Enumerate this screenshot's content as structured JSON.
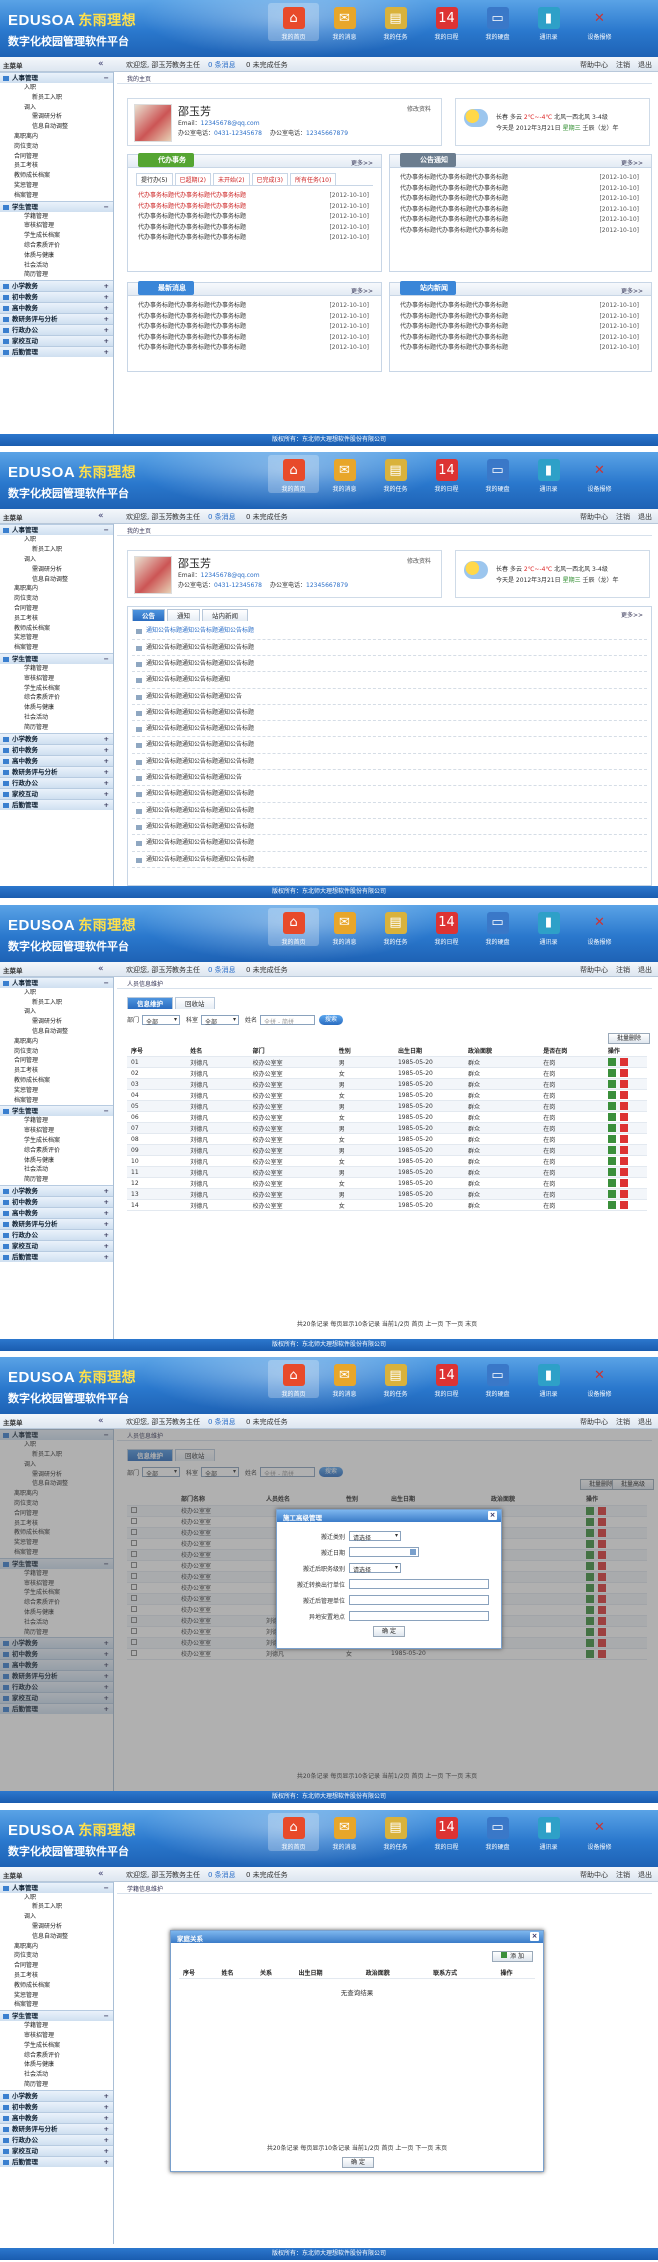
{
  "app": {
    "logo": "EDUSOA",
    "logo_cn": "东雨理想",
    "subtitle": "数字化校园管理软件平台",
    "nav": [
      {
        "label": "我的首页",
        "icon": "home-icon",
        "glyph": "⌂",
        "color": "#e84a2a"
      },
      {
        "label": "我的消息",
        "icon": "envelope-icon",
        "glyph": "✉",
        "color": "#e8a62a"
      },
      {
        "label": "我的任务",
        "icon": "folder-icon",
        "glyph": "▤",
        "color": "#d9b23c"
      },
      {
        "label": "我的日程",
        "icon": "calendar-icon",
        "glyph": "14",
        "color": "#d33"
      },
      {
        "label": "我的硬盘",
        "icon": "monitor-icon",
        "glyph": "▭",
        "color": "#3a78c8"
      },
      {
        "label": "通讯录",
        "icon": "addressbook-icon",
        "glyph": "▮",
        "color": "#2ea0c8"
      },
      {
        "label": "设备报修",
        "icon": "tools-icon",
        "glyph": "✕",
        "color": "#eee"
      }
    ],
    "toolbar": {
      "menu": "主菜单",
      "collapse": "«",
      "welcome": "欢迎您, 邵玉芳",
      "dept": "教务主任",
      "msg": "0 条消息",
      "task": "0 未完成任务",
      "help": "帮助中心",
      "logout": "注销",
      "exit": "退出"
    },
    "footer": "版权所有：东北师大理想软件股份有限公司"
  },
  "sidebar": {
    "groups_top": [
      {
        "label": "人事管理",
        "toggle": "−"
      }
    ],
    "hr_items": [
      {
        "label": "入职",
        "level": 2
      },
      {
        "label": "新员工入职",
        "level": 3
      },
      {
        "label": "调入",
        "level": 2
      },
      {
        "label": "需调研分析",
        "level": 3
      },
      {
        "label": "信息自动调整",
        "level": 3
      },
      {
        "label": "离职离内",
        "level": 1
      },
      {
        "label": "岗位变动",
        "level": 1
      },
      {
        "label": "合同管理",
        "level": 1
      },
      {
        "label": "员工考核",
        "level": 1
      },
      {
        "label": "教师成长档案",
        "level": 1
      },
      {
        "label": "奖惩管理",
        "level": 1
      },
      {
        "label": "档案管理",
        "level": 1
      }
    ],
    "student_group": {
      "label": "学生管理",
      "toggle": "−"
    },
    "student_items": [
      "学籍管理",
      "审核招管理",
      "学生成长档案",
      "综合素质评价",
      "体质与健康",
      "社会活动",
      "简历管理"
    ],
    "bottom_groups": [
      {
        "label": "小学教务",
        "toggle": "+"
      },
      {
        "label": "初中教务",
        "toggle": "+"
      },
      {
        "label": "高中教务",
        "toggle": "+"
      },
      {
        "label": "教研务评与分析",
        "toggle": "+"
      },
      {
        "label": "行政办公",
        "toggle": "+"
      },
      {
        "label": "家校互动",
        "toggle": "+"
      },
      {
        "label": "后勤管理",
        "toggle": "+"
      }
    ]
  },
  "home": {
    "breadcrumb": "我的主页",
    "profile": {
      "name": "邵玉芳",
      "email_label": "Email：",
      "email": "12345678@qq.com",
      "phone_label": "办公室电话：",
      "phone": "0431-12345678",
      "mobile_label": "办公室电话：",
      "mobile": "12345667879",
      "edit": "修改资料"
    },
    "weather": {
      "city": "长春",
      "cond": "多云",
      "temp": "2℃~-4℃",
      "wind": "北风一西北风  3-4级",
      "today": "今天是  2012年3月21日",
      "weekday": "星期三",
      "lunar": "壬辰（龙）年"
    },
    "todo": {
      "title": "代办事务",
      "more": "更多>>",
      "tabs": [
        "提行办(5)",
        "已超期(2)",
        "未开始(2)",
        "已完成(3)",
        "所有任务(10)"
      ],
      "rows": [
        {
          "text": "代办事务标题代办事务标题代办事务标题",
          "date": "[2012-10-10]",
          "red": true
        },
        {
          "text": "代办事务标题代办事务标题代办事务标题",
          "date": "[2012-10-10]",
          "red": true
        },
        {
          "text": "代办事务标题代办事务标题代办事务标题",
          "date": "[2012-10-10]",
          "red": false
        },
        {
          "text": "代办事务标题代办事务标题代办事务标题",
          "date": "[2012-10-10]",
          "red": false
        },
        {
          "text": "代办事务标题代办事务标题代办事务标题",
          "date": "[2012-10-10]",
          "red": false
        }
      ]
    },
    "notice": {
      "title": "公告通知",
      "more": "更多>>",
      "rows": [
        {
          "text": "代办事务标题代办事务标题代办事务标题",
          "date": "[2012-10-10]"
        },
        {
          "text": "代办事务标题代办事务标题代办事务标题",
          "date": "[2012-10-10]"
        },
        {
          "text": "代办事务标题代办事务标题代办事务标题",
          "date": "[2012-10-10]"
        },
        {
          "text": "代办事务标题代办事务标题代办事务标题",
          "date": "[2012-10-10]"
        },
        {
          "text": "代办事务标题代办事务标题代办事务标题",
          "date": "[2012-10-10]"
        },
        {
          "text": "代办事务标题代办事务标题代办事务标题",
          "date": "[2012-10-10]"
        }
      ]
    },
    "news": {
      "title": "最新消息",
      "more": "更多>>",
      "rows": [
        {
          "text": "代办事务标题代办事务标题代办事务标题",
          "date": "[2012-10-10]"
        },
        {
          "text": "代办事务标题代办事务标题代办事务标题",
          "date": "[2012-10-10]"
        },
        {
          "text": "代办事务标题代办事务标题代办事务标题",
          "date": "[2012-10-10]"
        },
        {
          "text": "代办事务标题代办事务标题代办事务标题",
          "date": "[2012-10-10]"
        },
        {
          "text": "代办事务标题代办事务标题代办事务标题",
          "date": "[2012-10-10]"
        }
      ]
    },
    "site_news": {
      "title": "站内新闻",
      "more": "更多>>",
      "rows": [
        {
          "text": "代办事务标题代办事务标题代办事务标题",
          "date": "[2012-10-10]"
        },
        {
          "text": "代办事务标题代办事务标题代办事务标题",
          "date": "[2012-10-10]"
        },
        {
          "text": "代办事务标题代办事务标题代办事务标题",
          "date": "[2012-10-10]"
        },
        {
          "text": "代办事务标题代办事务标题代办事务标题",
          "date": "[2012-10-10]"
        },
        {
          "text": "代办事务标题代办事务标题代办事务标题",
          "date": "[2012-10-10]"
        }
      ]
    }
  },
  "bulletin": {
    "tabs": [
      "公告",
      "通知",
      "站内新闻"
    ],
    "more": "更多>>",
    "items": [
      {
        "text": "通知公告标题通知公告标题通知公告标题",
        "hl": true
      },
      {
        "text": "通知公告标题通知公告标题通知公告标题",
        "hl": false
      },
      {
        "text": "通知公告标题通知公告标题通知公告标题",
        "hl": false
      },
      {
        "text": "通知公告标题通知公告标题通知",
        "hl": false
      },
      {
        "text": "通知公告标题通知公告标题通知公告",
        "hl": false
      },
      {
        "text": "通知公告标题通知公告标题通知公告标题",
        "hl": false
      },
      {
        "text": "通知公告标题通知公告标题通知公告标题",
        "hl": false
      },
      {
        "text": "通知公告标题通知公告标题通知公告标题",
        "hl": false
      },
      {
        "text": "通知公告标题通知公告标题通知公告标题",
        "hl": false
      },
      {
        "text": "通知公告标题通知公告标题通知公告",
        "hl": false
      },
      {
        "text": "通知公告标题通知公告标题通知公告标题",
        "hl": false
      },
      {
        "text": "通知公告标题通知公告标题通知公告标题",
        "hl": false
      },
      {
        "text": "通知公告标题通知公告标题通知公告标题",
        "hl": false
      },
      {
        "text": "通知公告标题通知公告标题通知公告标题",
        "hl": false
      },
      {
        "text": "通知公告标题通知公告标题通知公告标题",
        "hl": false
      }
    ]
  },
  "staff": {
    "breadcrumb": "人员信息维护",
    "tabs": [
      "信息维护",
      "回收站"
    ],
    "filter": {
      "dept_label": "部门",
      "dept_val": "全部",
      "room_label": "科室",
      "room_val": "全部",
      "name_label": "姓名",
      "name_ph": "全拼 - 简拼",
      "search": "搜索"
    },
    "batch_delete": "批量删除",
    "columns": [
      "序号",
      "姓名",
      "部门",
      "性别",
      "出生日期",
      "政治面貌",
      "是否在岗",
      "操作"
    ],
    "rows": [
      [
        "01",
        "刘德凡",
        "校办公室室",
        "男",
        "1985-05-20",
        "群众",
        "在岗"
      ],
      [
        "02",
        "刘德凡",
        "校办公室室",
        "女",
        "1985-05-20",
        "群众",
        "在岗"
      ],
      [
        "03",
        "刘德凡",
        "校办公室室",
        "男",
        "1985-05-20",
        "群众",
        "在岗"
      ],
      [
        "04",
        "刘德凡",
        "校办公室室",
        "女",
        "1985-05-20",
        "群众",
        "在岗"
      ],
      [
        "05",
        "刘德凡",
        "校办公室室",
        "男",
        "1985-05-20",
        "群众",
        "在岗"
      ],
      [
        "06",
        "刘德凡",
        "校办公室室",
        "女",
        "1985-05-20",
        "群众",
        "在岗"
      ],
      [
        "07",
        "刘德凡",
        "校办公室室",
        "男",
        "1985-05-20",
        "群众",
        "在岗"
      ],
      [
        "08",
        "刘德凡",
        "校办公室室",
        "女",
        "1985-05-20",
        "群众",
        "在岗"
      ],
      [
        "09",
        "刘德凡",
        "校办公室室",
        "男",
        "1985-05-20",
        "群众",
        "在岗"
      ],
      [
        "10",
        "刘德凡",
        "校办公室室",
        "女",
        "1985-05-20",
        "群众",
        "在岗"
      ],
      [
        "11",
        "刘德凡",
        "校办公室室",
        "男",
        "1985-05-20",
        "群众",
        "在岗"
      ],
      [
        "12",
        "刘德凡",
        "校办公室室",
        "女",
        "1985-05-20",
        "群众",
        "在岗"
      ],
      [
        "13",
        "刘德凡",
        "校办公室室",
        "男",
        "1985-05-20",
        "群众",
        "在岗"
      ],
      [
        "14",
        "刘德凡",
        "校办公室室",
        "女",
        "1985-05-20",
        "群众",
        "在岗"
      ]
    ],
    "pager": "共20条记录    每页显示10条记录    当前1/2页    首页    上一页    下一页    末页"
  },
  "dialog1": {
    "title": "施工高级管理",
    "fields": [
      {
        "label": "搬迁类别",
        "type": "select",
        "val": "请选择"
      },
      {
        "label": "搬迁日期",
        "type": "date",
        "val": ""
      },
      {
        "label": "搬迁后职务级别",
        "type": "select",
        "val": "请选择"
      },
      {
        "label": "搬迁转换出行单位",
        "type": "text",
        "val": ""
      },
      {
        "label": "搬迁后管理单位",
        "type": "text",
        "val": ""
      },
      {
        "label": "异地安置地点",
        "type": "text",
        "val": ""
      }
    ],
    "ok": "确 定",
    "bg_columns": [
      "部门名称",
      "人员姓名",
      "性别",
      "出生日期",
      "政治面貌",
      "操作"
    ],
    "bg_top_btn": "批量删除",
    "bg_top_btn2": "批量高级",
    "bg_rows": [
      "校办公室室",
      "校办公室室",
      "校办公室室",
      "校办公室室",
      "校办公室室",
      "校办公室室",
      "校办公室室",
      "校办公室室",
      "校办公室室",
      "校办公室室",
      "校办公室室",
      "校办公室室",
      "校办公室室",
      "校办公室室"
    ],
    "bg_names": [
      "",
      "",
      "",
      "",
      "",
      "",
      "",
      "",
      "",
      "",
      "刘德凡",
      "刘德凡",
      "刘德凡",
      "刘德凡"
    ],
    "bg_dates": [
      "",
      "",
      "",
      "",
      "",
      "",
      "",
      "",
      "",
      "",
      "1985-05-20",
      "1985-05-20",
      "1985-05-20",
      "1985-05-20"
    ],
    "bg_sex": [
      "",
      "",
      "",
      "",
      "",
      "",
      "",
      "",
      "",
      "",
      "男",
      "女",
      "男",
      "女"
    ]
  },
  "dialog2": {
    "breadcrumb": "学籍信息维护",
    "title": "家庭关系",
    "add": "添 加",
    "columns": [
      "序号",
      "姓名",
      "关系",
      "出生日期",
      "政治面貌",
      "联系方式",
      "操作"
    ],
    "empty": "无查询结果",
    "pager": "共20条记录    每页显示10条记录    当前1/2页    首页    上一页    下一页    末页",
    "ok": "确 定"
  }
}
